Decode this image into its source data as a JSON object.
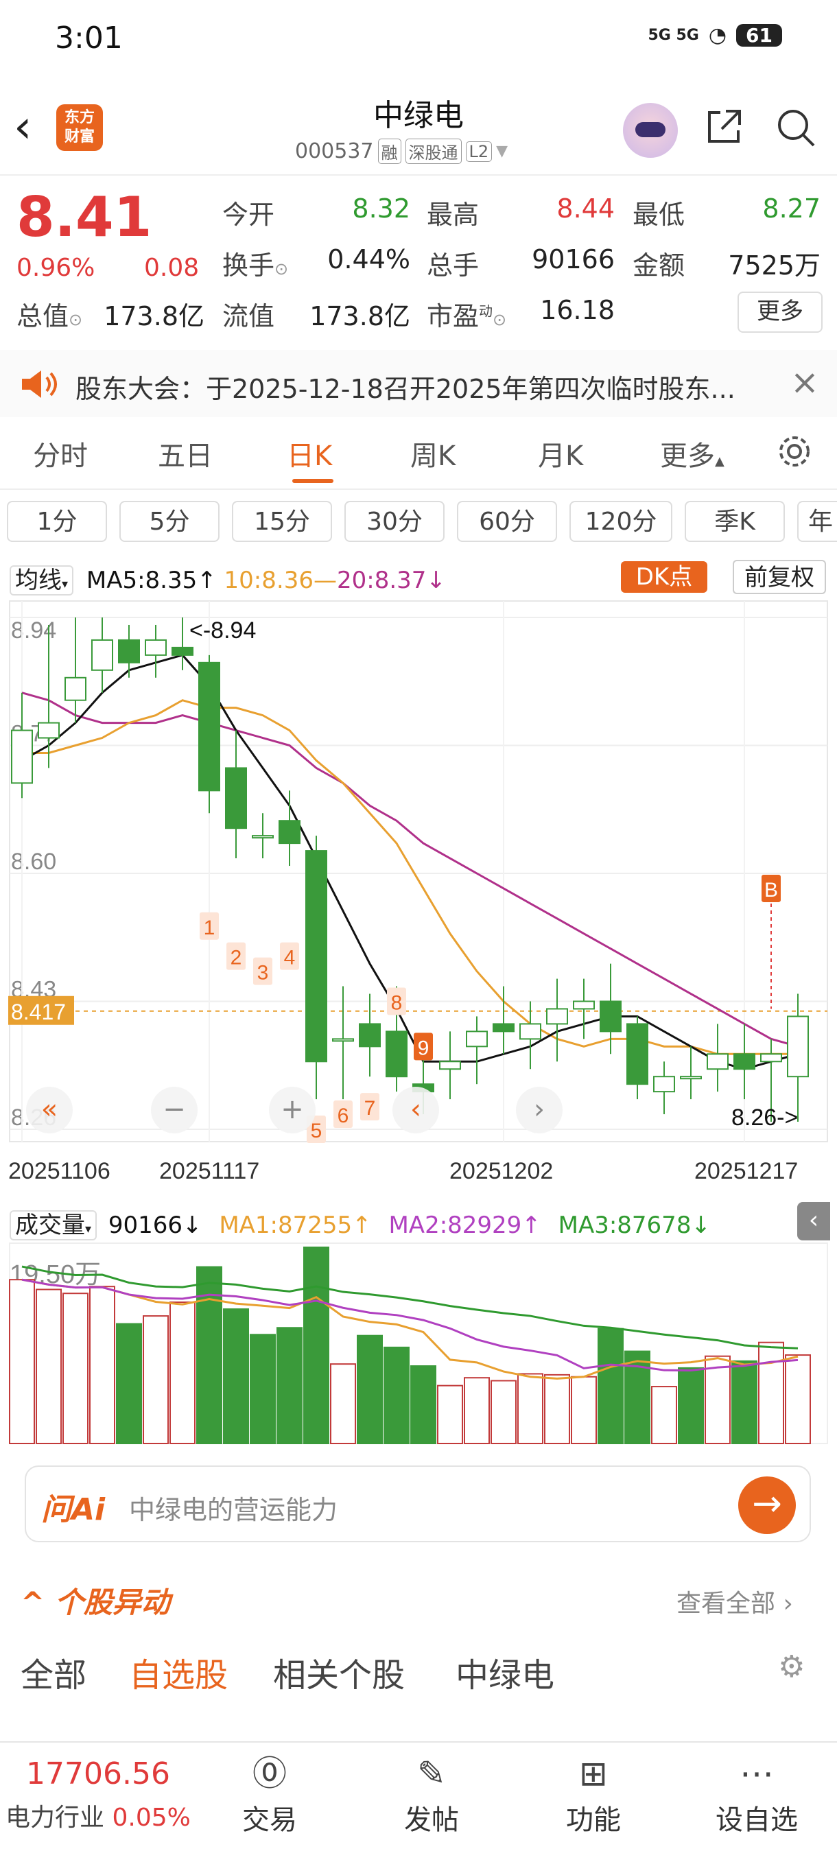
{
  "status_bar": {
    "time": "3:01",
    "network": "5G 5G",
    "battery": "61"
  },
  "header": {
    "stock_name": "中绿电",
    "code": "000537",
    "tags": [
      "融",
      "深股通",
      "L2"
    ],
    "logo_text": "东方财富"
  },
  "quote": {
    "price": "8.41",
    "change_pct": "0.96%",
    "change": "0.08",
    "rows": [
      [
        {
          "label": "今开",
          "value": "8.32",
          "color": "green"
        },
        {
          "label": "最高",
          "value": "8.44",
          "color": "red"
        },
        {
          "label": "最低",
          "value": "8.27",
          "color": "green"
        }
      ],
      [
        {
          "label": "换手",
          "value": "0.44%",
          "color": "black"
        },
        {
          "label": "总手",
          "value": "90166",
          "color": "black"
        },
        {
          "label": "金额",
          "value": "7525万",
          "color": "black"
        }
      ],
      [
        {
          "label": "总值",
          "value": "173.8亿",
          "color": "black"
        },
        {
          "label": "流值",
          "value": "173.8亿",
          "color": "black"
        },
        {
          "label": "市盈",
          "value": "16.18",
          "color": "black"
        }
      ]
    ],
    "pe_superscript": "动",
    "more_label": "更多"
  },
  "notice": {
    "text": "股东大会：于2025-12-18召开2025年第四次临时股东..."
  },
  "chart_tabs": {
    "items": [
      "分时",
      "五日",
      "日K",
      "周K",
      "月K",
      "更多"
    ],
    "active": "日K"
  },
  "periods": [
    "1分",
    "5分",
    "15分",
    "30分",
    "60分",
    "120分",
    "季K",
    "年"
  ],
  "ma_bar": {
    "selector": "均线",
    "ma5": "MA5:8.35↑",
    "ma10": "10:8.36",
    "ma20": "20:8.37↓",
    "dk": "DK点",
    "adjust": "前复权"
  },
  "volume_bar": {
    "selector": "成交量",
    "volume": "90166↓",
    "ma1": "MA1:87255↑",
    "ma2": "MA2:82929↑",
    "ma3": "MA3:87678↓"
  },
  "chart_data": [
    {
      "type": "candlestick",
      "y_ticks": [
        "8.94",
        "8.77",
        "8.60",
        "8.43",
        "8.26"
      ],
      "ylim": [
        8.26,
        8.94
      ],
      "current_price_marker": "8.417",
      "x_labels": [
        "20251106",
        "20251117",
        "20251202",
        "20251217"
      ],
      "annotations": {
        "high": "<-8.94",
        "low": "8.26->"
      },
      "signals": [
        "1",
        "2",
        "3",
        "4",
        "5",
        "6",
        "7",
        "8",
        "9",
        "B"
      ],
      "candles": [
        {
          "o": 8.72,
          "c": 8.79,
          "h": 8.84,
          "l": 8.7
        },
        {
          "o": 8.78,
          "c": 8.8,
          "h": 8.93,
          "l": 8.74
        },
        {
          "o": 8.83,
          "c": 8.86,
          "h": 8.94,
          "l": 8.8
        },
        {
          "o": 8.87,
          "c": 8.91,
          "h": 8.94,
          "l": 8.84
        },
        {
          "o": 8.91,
          "c": 8.88,
          "h": 8.93,
          "l": 8.86
        },
        {
          "o": 8.89,
          "c": 8.91,
          "h": 8.93,
          "l": 8.86
        },
        {
          "o": 8.9,
          "c": 8.89,
          "h": 8.94,
          "l": 8.87
        },
        {
          "o": 8.88,
          "c": 8.71,
          "h": 8.89,
          "l": 8.68
        },
        {
          "o": 8.74,
          "c": 8.66,
          "h": 8.79,
          "l": 8.62
        },
        {
          "o": 8.65,
          "c": 8.65,
          "h": 8.68,
          "l": 8.62
        },
        {
          "o": 8.67,
          "c": 8.64,
          "h": 8.71,
          "l": 8.61
        },
        {
          "o": 8.63,
          "c": 8.35,
          "h": 8.65,
          "l": 8.3
        },
        {
          "o": 8.38,
          "c": 8.38,
          "h": 8.45,
          "l": 8.3
        },
        {
          "o": 8.4,
          "c": 8.37,
          "h": 8.44,
          "l": 8.33
        },
        {
          "o": 8.39,
          "c": 8.33,
          "h": 8.45,
          "l": 8.31
        },
        {
          "o": 8.32,
          "c": 8.31,
          "h": 8.36,
          "l": 8.28
        },
        {
          "o": 8.34,
          "c": 8.35,
          "h": 8.39,
          "l": 8.3
        },
        {
          "o": 8.37,
          "c": 8.39,
          "h": 8.41,
          "l": 8.32
        },
        {
          "o": 8.4,
          "c": 8.39,
          "h": 8.45,
          "l": 8.36
        },
        {
          "o": 8.38,
          "c": 8.4,
          "h": 8.43,
          "l": 8.34
        },
        {
          "o": 8.4,
          "c": 8.42,
          "h": 8.46,
          "l": 8.35
        },
        {
          "o": 8.42,
          "c": 8.43,
          "h": 8.46,
          "l": 8.38
        },
        {
          "o": 8.43,
          "c": 8.39,
          "h": 8.48,
          "l": 8.36
        },
        {
          "o": 8.4,
          "c": 8.32,
          "h": 8.41,
          "l": 8.3
        },
        {
          "o": 8.31,
          "c": 8.33,
          "h": 8.35,
          "l": 8.28
        },
        {
          "o": 8.33,
          "c": 8.33,
          "h": 8.37,
          "l": 8.3
        },
        {
          "o": 8.34,
          "c": 8.36,
          "h": 8.4,
          "l": 8.31
        },
        {
          "o": 8.36,
          "c": 8.34,
          "h": 8.4,
          "l": 8.3
        },
        {
          "o": 8.35,
          "c": 8.36,
          "h": 8.38,
          "l": 8.27
        },
        {
          "o": 8.33,
          "c": 8.41,
          "h": 8.44,
          "l": 8.27
        }
      ],
      "ma5": [
        8.75,
        8.77,
        8.8,
        8.84,
        8.87,
        8.88,
        8.89,
        8.85,
        8.79,
        8.74,
        8.69,
        8.62,
        8.55,
        8.48,
        8.42,
        8.35,
        8.35,
        8.35,
        8.36,
        8.37,
        8.39,
        8.4,
        8.41,
        8.41,
        8.39,
        8.37,
        8.35,
        8.34,
        8.35,
        8.36
      ],
      "ma10": [
        8.76,
        8.76,
        8.77,
        8.78,
        8.8,
        8.81,
        8.83,
        8.82,
        8.82,
        8.81,
        8.79,
        8.75,
        8.72,
        8.68,
        8.64,
        8.58,
        8.52,
        8.47,
        8.43,
        8.4,
        8.38,
        8.37,
        8.38,
        8.38,
        8.37,
        8.37,
        8.36,
        8.36,
        8.36,
        8.36
      ],
      "ma20": [
        8.84,
        8.83,
        8.81,
        8.8,
        8.8,
        8.8,
        8.81,
        8.8,
        8.79,
        8.78,
        8.77,
        8.74,
        8.72,
        8.69,
        8.67,
        8.64,
        8.62,
        8.6,
        8.58,
        8.56,
        8.54,
        8.52,
        8.5,
        8.48,
        8.46,
        8.44,
        8.42,
        8.4,
        8.38,
        8.37
      ]
    },
    {
      "type": "bar",
      "title": "成交量",
      "y_ticks": [
        "19.50万"
      ],
      "ylim": [
        0,
        200000
      ],
      "values": [
        167000,
        157000,
        153000,
        160000,
        122000,
        130000,
        144000,
        180000,
        137000,
        111000,
        118000,
        200000,
        81000,
        110000,
        98000,
        79000,
        59000,
        67000,
        64000,
        71000,
        70000,
        68000,
        117000,
        94000,
        58000,
        77000,
        89000,
        84000,
        103000,
        90166
      ],
      "up": [
        true,
        true,
        true,
        true,
        false,
        true,
        true,
        false,
        false,
        false,
        false,
        false,
        true,
        false,
        false,
        false,
        true,
        true,
        true,
        true,
        true,
        true,
        false,
        false,
        true,
        false,
        true,
        false,
        true,
        true
      ]
    }
  ],
  "ask_ai": {
    "logo": "问Ai",
    "placeholder": "中绿电的营运能力"
  },
  "movers": {
    "title": "个股异动",
    "view_all": "查看全部",
    "tabs": [
      "全部",
      "自选股",
      "相关个股",
      "中绿电"
    ],
    "active": "自选股"
  },
  "bottom_nav": {
    "index_value": "17706.56",
    "index_name": "电力行业",
    "index_pct": "0.05%",
    "items": [
      {
        "label": "交易",
        "icon": "yen-icon"
      },
      {
        "label": "发帖",
        "icon": "edit-icon"
      },
      {
        "label": "功能",
        "icon": "grid-icon"
      },
      {
        "label": "设自选",
        "icon": "more-icon"
      }
    ]
  },
  "colors": {
    "accent": "#e8641e",
    "up": "#e03a3a",
    "down": "#2f9a2f",
    "ma5": "#111111",
    "ma10": "#e8a030",
    "ma20": "#b0308a",
    "vma1": "#e8a030",
    "vma2": "#b040c0",
    "vma3": "#2f9a2f"
  }
}
